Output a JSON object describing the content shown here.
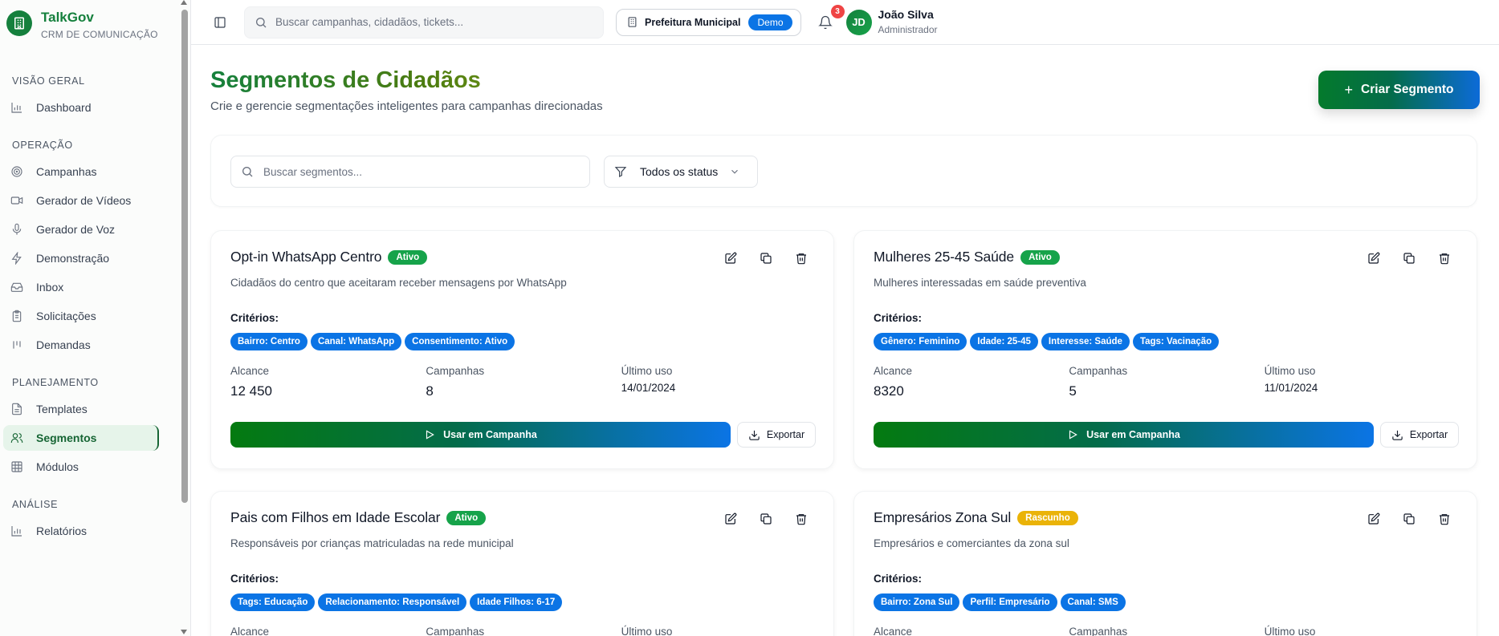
{
  "app": {
    "name": "TalkGov",
    "subtitle": "CRM DE COMUNICAÇÃO"
  },
  "sidebar": {
    "sections": [
      {
        "title": "VISÃO GERAL",
        "items": [
          {
            "label": "Dashboard",
            "icon": "bar-chart-icon"
          }
        ]
      },
      {
        "title": "OPERAÇÃO",
        "items": [
          {
            "label": "Campanhas",
            "icon": "target-icon"
          },
          {
            "label": "Gerador de Vídeos",
            "icon": "video-icon"
          },
          {
            "label": "Gerador de Voz",
            "icon": "mic-icon"
          },
          {
            "label": "Demonstração",
            "icon": "zap-icon"
          },
          {
            "label": "Inbox",
            "icon": "inbox-icon"
          },
          {
            "label": "Solicitações",
            "icon": "clipboard-icon"
          },
          {
            "label": "Demandas",
            "icon": "kanban-icon"
          }
        ]
      },
      {
        "title": "PLANEJAMENTO",
        "items": [
          {
            "label": "Templates",
            "icon": "file-text-icon"
          },
          {
            "label": "Segmentos",
            "icon": "users-icon",
            "active": true
          },
          {
            "label": "Módulos",
            "icon": "grid-icon"
          }
        ]
      },
      {
        "title": "ANÁLISE",
        "items": [
          {
            "label": "Relatórios",
            "icon": "bar-chart-icon"
          }
        ]
      }
    ]
  },
  "topbar": {
    "search_placeholder": "Buscar campanhas, cidadãos, tickets...",
    "org": "Prefeitura Municipal",
    "env_badge": "Demo",
    "notifications": "3",
    "user": {
      "initials": "JD",
      "name": "João Silva",
      "role": "Administrador"
    }
  },
  "page": {
    "title": "Segmentos de Cidadãos",
    "subtitle": "Crie e gerencie segmentações inteligentes para campanhas direcionadas",
    "create_button": "Criar Segmento",
    "search_placeholder": "Buscar segmentos...",
    "status_filter": "Todos os status"
  },
  "labels": {
    "criteria": "Critérios:",
    "reach": "Alcance",
    "campaigns": "Campanhas",
    "last_use": "Último uso",
    "use_button": "Usar em Campanha",
    "export_button": "Exportar"
  },
  "segments": [
    {
      "name": "Opt-in WhatsApp Centro",
      "status": "Ativo",
      "description": "Cidadãos do centro que aceitaram receber mensagens por WhatsApp",
      "criteria": [
        "Bairro: Centro",
        "Canal: WhatsApp",
        "Consentimento: Ativo"
      ],
      "reach": "12 450",
      "campaigns": "8",
      "last_use": "14/01/2024"
    },
    {
      "name": "Mulheres 25-45 Saúde",
      "status": "Ativo",
      "description": "Mulheres interessadas em saúde preventiva",
      "criteria": [
        "Gênero: Feminino",
        "Idade: 25-45",
        "Interesse: Saúde",
        "Tags: Vacinação"
      ],
      "reach": "8320",
      "campaigns": "5",
      "last_use": "11/01/2024"
    },
    {
      "name": "Pais com Filhos em Idade Escolar",
      "status": "Ativo",
      "description": "Responsáveis por crianças matriculadas na rede municipal",
      "criteria": [
        "Tags: Educação",
        "Relacionamento: Responsável",
        "Idade Filhos: 6-17"
      ]
    },
    {
      "name": "Empresários Zona Sul",
      "status": "Rascunho",
      "description": "Empresários e comerciantes da zona sul",
      "criteria": [
        "Bairro: Zona Sul",
        "Perfil: Empresário",
        "Canal: SMS"
      ]
    }
  ],
  "colors": {
    "brand": "#15803d",
    "accent_blue": "#0b74e5",
    "status_active": "#16a34a",
    "status_draft": "#eab308"
  }
}
